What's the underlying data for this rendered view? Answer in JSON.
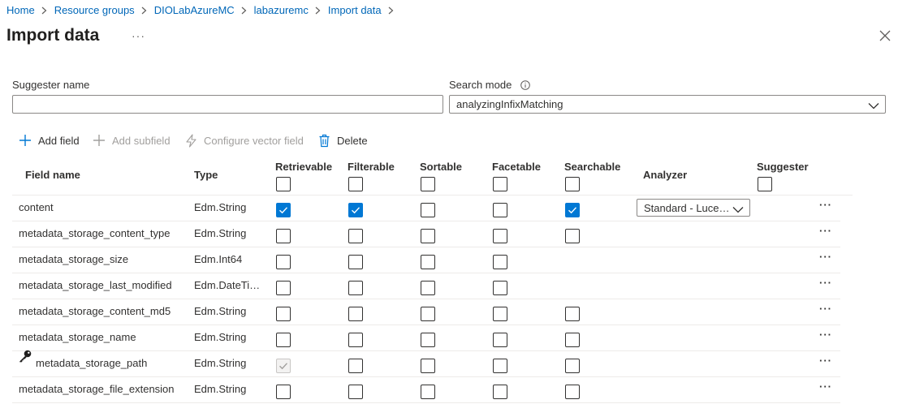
{
  "breadcrumb": [
    "Home",
    "Resource groups",
    "DIOLabAzureMC",
    "labazuremc",
    "Import data"
  ],
  "page": {
    "title": "Import data",
    "more": "···"
  },
  "form": {
    "suggester_label": "Suggester name",
    "suggester_value": "",
    "search_mode_label": "Search mode",
    "search_mode_value": "analyzingInfixMatching"
  },
  "toolbar": {
    "add_field": "Add field",
    "add_subfield": "Add subfield",
    "configure_vector_field": "Configure vector field",
    "delete": "Delete"
  },
  "columns": [
    "Field name",
    "Type",
    "Retrievable",
    "Filterable",
    "Sortable",
    "Facetable",
    "Searchable",
    "Analyzer",
    "Suggester"
  ],
  "header_checks": [
    "Retrievable",
    "Filterable",
    "Sortable",
    "Facetable",
    "Searchable",
    "Suggester"
  ],
  "rows": [
    {
      "name": "content",
      "type": "Edm.String",
      "retrievable": true,
      "filterable": true,
      "sortable": false,
      "facetable": false,
      "searchable": true,
      "analyzer": "Standard - Luce…",
      "more": "···"
    },
    {
      "name": "metadata_storage_content_type",
      "type": "Edm.String",
      "retrievable": false,
      "filterable": false,
      "sortable": false,
      "facetable": false,
      "searchable": false,
      "more": "···"
    },
    {
      "name": "metadata_storage_size",
      "type": "Edm.Int64",
      "retrievable": false,
      "filterable": false,
      "sortable": false,
      "facetable": false,
      "more": "···"
    },
    {
      "name": "metadata_storage_last_modified",
      "type": "Edm.DateTi…",
      "retrievable": false,
      "filterable": false,
      "sortable": false,
      "facetable": false,
      "more": "···"
    },
    {
      "name": "metadata_storage_content_md5",
      "type": "Edm.String",
      "retrievable": false,
      "filterable": false,
      "sortable": false,
      "facetable": false,
      "searchable": false,
      "more": "···"
    },
    {
      "name": "metadata_storage_name",
      "type": "Edm.String",
      "retrievable": false,
      "filterable": false,
      "sortable": false,
      "facetable": false,
      "searchable": false,
      "more": "···"
    },
    {
      "name": "metadata_storage_path",
      "type": "Edm.String",
      "key": true,
      "retrievable": true,
      "retrievable_disabled": true,
      "filterable": false,
      "sortable": false,
      "facetable": false,
      "searchable": false,
      "more": "···"
    },
    {
      "name": "metadata_storage_file_extension",
      "type": "Edm.String",
      "retrievable": false,
      "filterable": false,
      "sortable": false,
      "facetable": false,
      "searchable": false,
      "more": "···"
    }
  ],
  "colors": {
    "accent": "#0078d4",
    "link": "#0067b8"
  }
}
